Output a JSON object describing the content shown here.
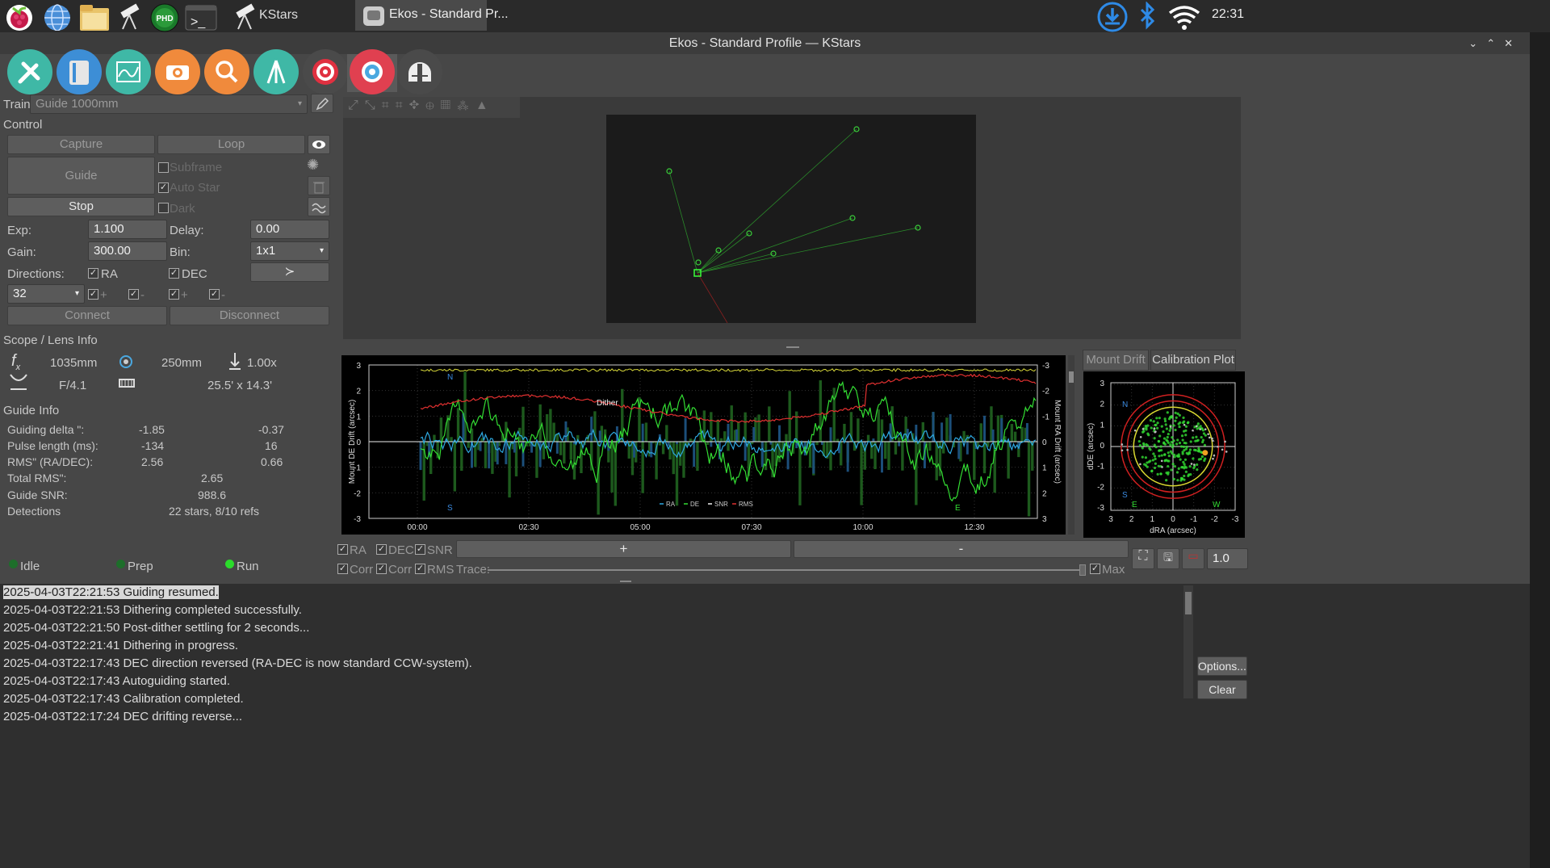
{
  "taskbar": {
    "items": [
      {
        "label": "KStars"
      },
      {
        "label": "Ekos - Standard Pr..."
      }
    ],
    "clock": "22:31"
  },
  "window": {
    "title": "Ekos - Standard Profile — KStars"
  },
  "train": {
    "label": "Train:",
    "value": "Guide 1000mm"
  },
  "control": {
    "section": "Control",
    "capture": "Capture",
    "loop": "Loop",
    "guide": "Guide",
    "stop": "Stop",
    "subframe": "Subframe",
    "auto_star": "Auto Star",
    "dark": "Dark",
    "exp_label": "Exp:",
    "exp_value": "1.100",
    "delay_label": "Delay:",
    "delay_value": "0.00",
    "gain_label": "Gain:",
    "gain_value": "300.00",
    "bin_label": "Bin:",
    "bin_value": "1x1",
    "directions_label": "Directions:",
    "ra": "RA",
    "dec": "DEC",
    "box_value": "32",
    "plus": "+",
    "minus": "-",
    "connect": "Connect",
    "disconnect": "Disconnect"
  },
  "scope": {
    "section": "Scope / Lens Info",
    "focal": "1035mm",
    "aperture": "250mm",
    "reducer": "1.00x",
    "fratio": "F/4.1",
    "fov": "25.5' x 14.3'"
  },
  "guide_info": {
    "section": "Guide Info",
    "rows": [
      {
        "label": "Guiding delta \":",
        "a": "-1.85",
        "b": "-0.37"
      },
      {
        "label": "Pulse length (ms):",
        "a": "-134",
        "b": "16"
      },
      {
        "label": "RMS\" (RA/DEC):",
        "a": "2.56",
        "b": "0.66"
      }
    ],
    "total_rms_label": "Total RMS\":",
    "total_rms": "2.65",
    "snr_label": "Guide SNR:",
    "snr": "988.6",
    "det_label": "Detections",
    "det": "22 stars, 8/10 refs"
  },
  "status": {
    "idle": "Idle",
    "prep": "Prep",
    "run": "Run"
  },
  "drift_graph": {
    "ylabel_left": "Mount DE Drift (arcsec)",
    "ylabel_right": "Mount RA Drift (arcsec)",
    "annot_n": "N",
    "annot_s": "S",
    "annot_e": "E",
    "annot_dither": "Dither",
    "legend": [
      {
        "name": "RA",
        "color": "#2ea8e0"
      },
      {
        "name": "DE",
        "color": "#33dd33"
      },
      {
        "name": "SNR",
        "color": "#f0f0f0"
      },
      {
        "name": "RMS",
        "color": "#e03030"
      }
    ],
    "yticks_left": [
      "3",
      "2",
      "1",
      "0",
      "-1",
      "-2",
      "-3"
    ],
    "yticks_right": [
      "-3",
      "-2",
      "-1",
      "0",
      "1",
      "2",
      "3"
    ],
    "xticks": [
      "00:00",
      "02:30",
      "05:00",
      "07:30",
      "10:00",
      "12:30"
    ]
  },
  "scatter_plot": {
    "tab1": "Mount Drift",
    "tab2": "Calibration Plot",
    "xlabel": "dRA (arcsec)",
    "ylabel": "dDE (arcsec)",
    "yticks": [
      "3",
      "2",
      "1",
      "0",
      "-1",
      "-2",
      "-3"
    ],
    "xticks": [
      "3",
      "2",
      "1",
      "0",
      "-1",
      "-2",
      "-3"
    ],
    "n": "N",
    "s": "S",
    "e": "E",
    "w": "W"
  },
  "graph_controls": {
    "ra": "RA",
    "dec": "DEC",
    "snr": "SNR",
    "corr1": "Corr",
    "corr2": "Corr",
    "rms": "RMS",
    "trace": "Trace:",
    "plus": "+",
    "minus": "-",
    "max": "Max",
    "zoom": "1.0"
  },
  "log": {
    "lines": [
      "2025-04-03T22:21:53 Guiding resumed.",
      "2025-04-03T22:21:53 Dithering completed successfully.",
      "2025-04-03T22:21:50 Post-dither settling for 2 seconds...",
      "2025-04-03T22:21:41 Dithering in progress.",
      "2025-04-03T22:17:43 DEC direction reversed (RA-DEC is now standard CCW-system).",
      "2025-04-03T22:17:43 Autoguiding started.",
      "2025-04-03T22:17:43 Calibration completed.",
      "2025-04-03T22:17:24 DEC drifting reverse..."
    ],
    "options": "Options...",
    "clear": "Clear"
  }
}
